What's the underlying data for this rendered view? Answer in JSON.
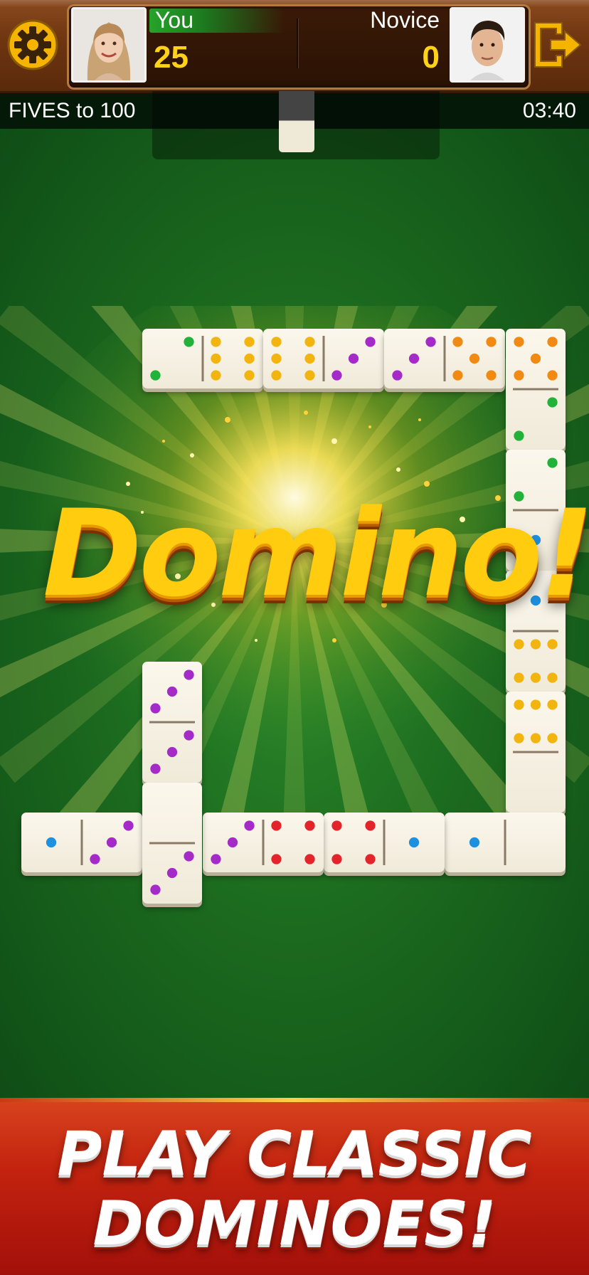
{
  "header": {
    "player_you": {
      "name": "You",
      "score": "25"
    },
    "player_opponent": {
      "name": "Novice",
      "score": "0"
    }
  },
  "status": {
    "mode": "FIVES to 100",
    "timer": "03:40"
  },
  "overlay": {
    "title": "Domino!"
  },
  "banner": {
    "line1": "PLAY CLASSIC",
    "line2": "DOMINOES!"
  },
  "pip_colors": {
    "1": "#1e90e0",
    "2": "#22b23a",
    "3": "#a52bc9",
    "4": "#e3242b",
    "5": "#f08a12",
    "6": "#f2b50f"
  },
  "board": [
    {
      "a": 2,
      "b": 6,
      "orientation": "horizontal"
    },
    {
      "a": 6,
      "b": 3,
      "orientation": "horizontal"
    },
    {
      "a": 3,
      "b": 5,
      "orientation": "horizontal"
    },
    {
      "a": 5,
      "b": 2,
      "orientation": "vertical"
    },
    {
      "a": 2,
      "b": 1,
      "orientation": "vertical"
    },
    {
      "a": 1,
      "b": 6,
      "orientation": "vertical"
    },
    {
      "a": 6,
      "b": 0,
      "orientation": "vertical"
    },
    {
      "a": 1,
      "b": 0,
      "orientation": "horizontal"
    },
    {
      "a": 4,
      "b": 1,
      "orientation": "horizontal"
    },
    {
      "a": 3,
      "b": 4,
      "orientation": "horizontal"
    },
    {
      "a": 3,
      "b": 3,
      "orientation": "vertical"
    },
    {
      "a": 1,
      "b": 3,
      "orientation": "horizontal"
    },
    {
      "a": 0,
      "b": 3,
      "orientation": "vertical"
    }
  ]
}
